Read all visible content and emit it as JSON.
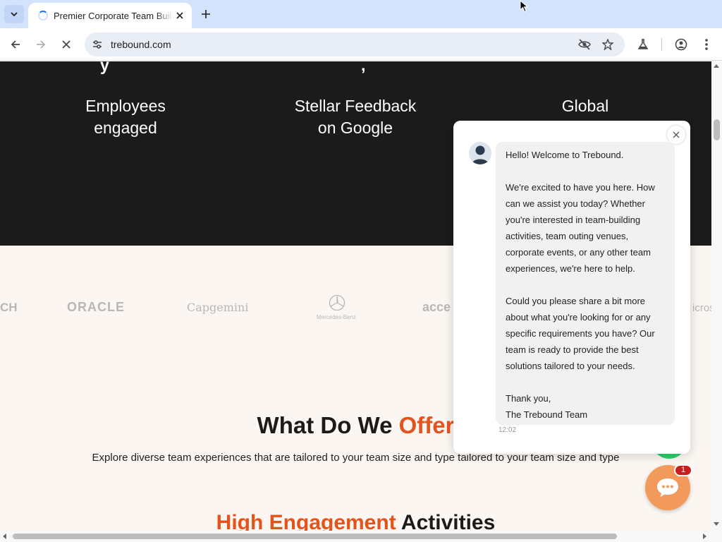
{
  "browser": {
    "tab_title": "Premier Corporate Team Building",
    "url": "trebound.com"
  },
  "page": {
    "stats": [
      {
        "label_line1": "Employees",
        "label_line2": "engaged"
      },
      {
        "label_line1": "Stellar Feedback",
        "label_line2": "on Google"
      },
      {
        "label_line1": "Global",
        "label_line2": ""
      }
    ],
    "logos": [
      "CH",
      "ORACLE",
      "Capgemini",
      "Mercedes-Benz",
      "acce",
      "icros"
    ],
    "offer_title_main": "What Do We ",
    "offer_title_accent": "Offer",
    "offer_subtitle": "Explore diverse team experiences that are tailored to your team size and type tailored to your team size and type",
    "activities_title_accent": "High Engagement",
    "activities_title_main": " Activities"
  },
  "chat": {
    "lines": [
      "Hello! Welcome to Trebound.",
      "",
      "We're excited to have you here. How",
      "can we assist you today? Whether",
      "you're interested in team-building",
      "activities, team outing venues,",
      "corporate events, or any other team",
      "experiences, we're here to help.",
      "",
      "Could you please share a bit more",
      "about what you're looking for or any",
      "specific requirements you have? Our",
      "team is ready to provide the best",
      "solutions tailored to your needs.",
      "",
      "Thank you,",
      "The Trebound Team"
    ],
    "time": "12:02",
    "unread_count": "1"
  }
}
